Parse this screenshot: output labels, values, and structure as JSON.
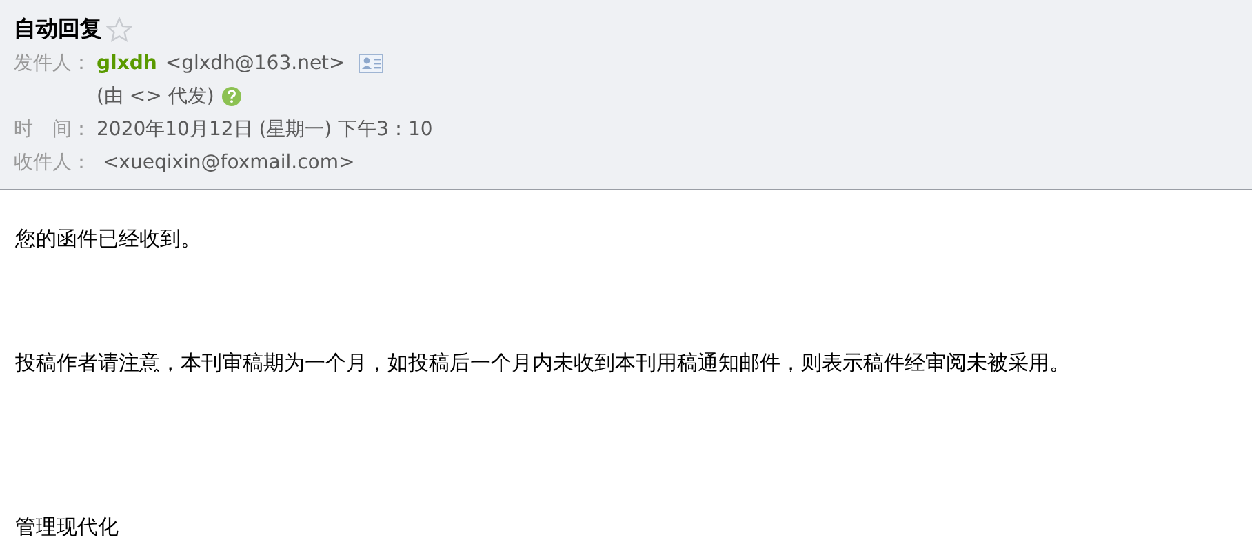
{
  "header": {
    "subject": "自动回复",
    "starred": false,
    "fields": [
      {
        "kind": "sender",
        "label": "发件人：",
        "name": "glxdh",
        "address": "<glxdh@163.net>",
        "note": "(由 <> 代发)"
      },
      {
        "kind": "plain",
        "label": "时　间：",
        "value": "2020年10月12日 (星期一) 下午3：10"
      },
      {
        "kind": "plain",
        "label": "收件人：",
        "value": " <xueqixin@foxmail.com>"
      }
    ]
  },
  "body": [
    {
      "text": "您的函件已经收到。"
    },
    {
      "text": "投稿作者请注意，本刊审稿期为一个月，如投稿后一个月内未收到本刊用稿通知邮件，则表示稿件经审阅未被采用。"
    },
    {
      "text": "管理现代化"
    }
  ]
}
